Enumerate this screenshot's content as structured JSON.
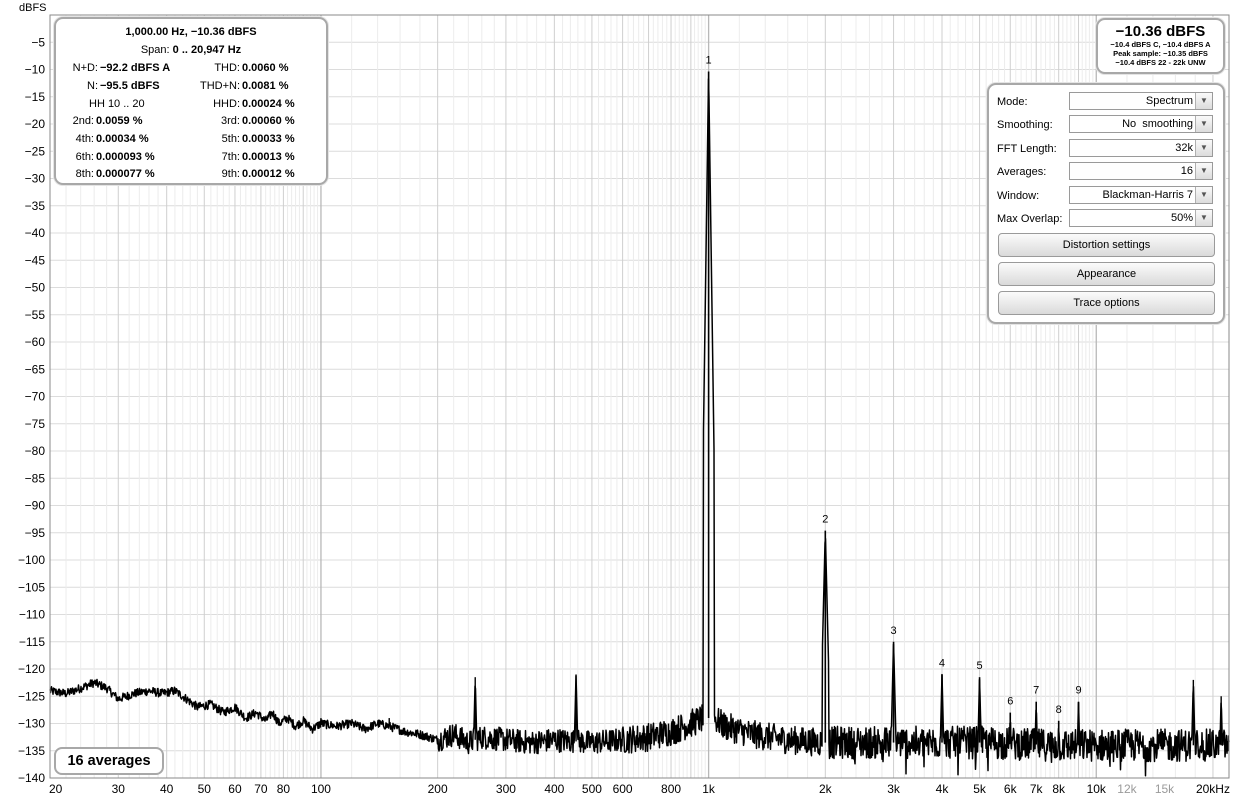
{
  "chart_data": {
    "type": "line",
    "ylabel": "dBFS",
    "xlabel": "",
    "xscale": "log",
    "xlim": [
      20,
      22000
    ],
    "ylim": [
      -140,
      0
    ],
    "grid": true,
    "x_tick_labels": [
      {
        "v": 20,
        "t": "20"
      },
      {
        "v": 30,
        "t": "30"
      },
      {
        "v": 40,
        "t": "40"
      },
      {
        "v": 50,
        "t": "50"
      },
      {
        "v": 60,
        "t": "60"
      },
      {
        "v": 70,
        "t": "70"
      },
      {
        "v": 80,
        "t": "80"
      },
      {
        "v": 100,
        "t": "100"
      },
      {
        "v": 200,
        "t": "200"
      },
      {
        "v": 300,
        "t": "300"
      },
      {
        "v": 400,
        "t": "400"
      },
      {
        "v": 500,
        "t": "500"
      },
      {
        "v": 600,
        "t": "600"
      },
      {
        "v": 800,
        "t": "800"
      },
      {
        "v": 1000,
        "t": "1k"
      },
      {
        "v": 2000,
        "t": "2k"
      },
      {
        "v": 3000,
        "t": "3k"
      },
      {
        "v": 4000,
        "t": "4k"
      },
      {
        "v": 5000,
        "t": "5k"
      },
      {
        "v": 6000,
        "t": "6k"
      },
      {
        "v": 7000,
        "t": "7k"
      },
      {
        "v": 8000,
        "t": "8k"
      },
      {
        "v": 10000,
        "t": "10k"
      },
      {
        "v": 12000,
        "t": "12k"
      },
      {
        "v": 15000,
        "t": "15k"
      },
      {
        "v": 20000,
        "t": "20kHz"
      }
    ],
    "x_tick_gray": [
      "12k",
      "15k"
    ],
    "y_ticks": [
      -5,
      -10,
      -15,
      -20,
      -25,
      -30,
      -35,
      -40,
      -45,
      -50,
      -55,
      -60,
      -65,
      -70,
      -75,
      -80,
      -85,
      -90,
      -95,
      -100,
      -105,
      -110,
      -115,
      -120,
      -125,
      -130,
      -135,
      -140
    ],
    "noise_floor": [
      [
        20,
        -124
      ],
      [
        22,
        -124.5
      ],
      [
        24,
        -123.5
      ],
      [
        26,
        -122.5
      ],
      [
        28,
        -123.5
      ],
      [
        30,
        -125.5
      ],
      [
        33,
        -124.5
      ],
      [
        36,
        -124
      ],
      [
        39,
        -124.5
      ],
      [
        42,
        -124
      ],
      [
        45,
        -125.5
      ],
      [
        48,
        -127
      ],
      [
        52,
        -126.5
      ],
      [
        56,
        -128
      ],
      [
        60,
        -127
      ],
      [
        64,
        -129
      ],
      [
        68,
        -128
      ],
      [
        72,
        -129.5
      ],
      [
        75,
        -128
      ],
      [
        78,
        -130
      ],
      [
        82,
        -129
      ],
      [
        86,
        -130.5
      ],
      [
        90,
        -129.5
      ],
      [
        95,
        -131
      ],
      [
        100,
        -130
      ],
      [
        110,
        -130.5
      ],
      [
        120,
        -130
      ],
      [
        130,
        -131
      ],
      [
        140,
        -130
      ],
      [
        150,
        -130.5
      ],
      [
        165,
        -131.5
      ],
      [
        180,
        -132
      ],
      [
        200,
        -133
      ],
      [
        220,
        -132
      ],
      [
        240,
        -133.5
      ],
      [
        260,
        -132.5
      ],
      [
        300,
        -133
      ],
      [
        350,
        -133.5
      ],
      [
        400,
        -133
      ],
      [
        500,
        -133.5
      ],
      [
        600,
        -133
      ],
      [
        700,
        -132.5
      ],
      [
        800,
        -131.5
      ],
      [
        900,
        -130
      ],
      [
        970,
        -129
      ],
      [
        1030,
        -129
      ],
      [
        1100,
        -130.5
      ],
      [
        1300,
        -132
      ],
      [
        1600,
        -133
      ],
      [
        2000,
        -133.5
      ],
      [
        3000,
        -133.5
      ],
      [
        5000,
        -133.5
      ],
      [
        8000,
        -134
      ],
      [
        12000,
        -134
      ],
      [
        16000,
        -134
      ],
      [
        22000,
        -134
      ]
    ],
    "harmonic_markers": [
      {
        "x": 1000,
        "y": -10.36,
        "label": "1"
      },
      {
        "x": 2000,
        "y": -94.6,
        "label": "2"
      },
      {
        "x": 3000,
        "y": -115,
        "label": "3"
      },
      {
        "x": 4000,
        "y": -121,
        "label": "4"
      },
      {
        "x": 5000,
        "y": -121.5,
        "label": "5"
      },
      {
        "x": 6000,
        "y": -128,
        "label": "6"
      },
      {
        "x": 7000,
        "y": -126,
        "label": "7"
      },
      {
        "x": 8000,
        "y": -129.5,
        "label": "8"
      },
      {
        "x": 9000,
        "y": -126,
        "label": "9"
      }
    ],
    "other_peaks": [
      {
        "x": 100,
        "y": -129
      },
      {
        "x": 150,
        "y": -129
      },
      {
        "x": 250,
        "y": -121.5
      },
      {
        "x": 455,
        "y": -121
      },
      {
        "x": 17800,
        "y": -122
      },
      {
        "x": 21000,
        "y": -125
      }
    ],
    "series": [
      {
        "values_desc": "spectrum",
        "color": "#000000"
      }
    ]
  },
  "stats": {
    "header": "1,000.00 Hz, −10.36 dBFS",
    "span_label": "Span:",
    "span_value": "0 .. 20,947 Hz",
    "nd_label": "N+D:",
    "nd_value": "−92.2 dBFS A",
    "thd_label": "THD:",
    "thd_value": "0.0060 %",
    "n_label": "N:",
    "n_value": "−95.5 dBFS",
    "thdn_label": "THD+N:",
    "thdn_value": "0.0081 %",
    "hh_label": "HH 10 .. 20",
    "hhd_label": "HHD:",
    "hhd_value": "0.00024 %",
    "h2_label": "2nd:",
    "h2_value": "0.0059 %",
    "h3_label": "3rd:",
    "h3_value": "0.00060 %",
    "h4_label": "4th:",
    "h4_value": "0.00034 %",
    "h5_label": "5th:",
    "h5_value": "0.00033 %",
    "h6_label": "6th:",
    "h6_value": "0.000093 %",
    "h7_label": "7th:",
    "h7_value": "0.00013 %",
    "h8_label": "8th:",
    "h8_value": "0.000077 %",
    "h9_label": "9th:",
    "h9_value": "0.00012 %"
  },
  "level": {
    "main": "−10.36 dBFS",
    "line1": "−10.4 dBFS C, −10.4 dBFS A",
    "line2": "Peak sample: −10.35 dBFS",
    "line3": "−10.4 dBFS 22 - 22k UNW"
  },
  "controls": {
    "mode_label": "Mode:",
    "mode_value": "Spectrum",
    "smoothing_label": "Smoothing:",
    "smoothing_value": "No  smoothing",
    "fft_label": "FFT Length:",
    "fft_value": "32k",
    "averages_label": "Averages:",
    "averages_value": "16",
    "window_label": "Window:",
    "window_value": "Blackman-Harris 7",
    "overlap_label": "Max Overlap:",
    "overlap_value": "50%",
    "distortion_button": "Distortion settings",
    "appearance_button": "Appearance",
    "trace_button": "Trace options"
  },
  "averages_badge": "16 averages"
}
